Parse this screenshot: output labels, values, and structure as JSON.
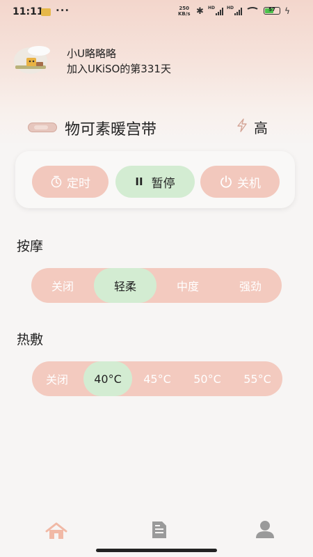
{
  "status_bar": {
    "time": "11:11",
    "more": "···",
    "net_speed_value": "250",
    "net_speed_unit": "KB/s",
    "hd1": "HD",
    "hd2": "HD",
    "battery": "57",
    "icons": [
      "notification-icon",
      "bluetooth-icon",
      "signal-icon",
      "wifi-icon",
      "battery-icon",
      "charging-icon"
    ]
  },
  "profile": {
    "username": "小U略略略",
    "days_text": "加入UKiSO的第331天"
  },
  "device": {
    "name": "物可素暖宫带",
    "level": "高"
  },
  "controls": {
    "timer_label": "定时",
    "pause_label": "暂停",
    "power_label": "关机",
    "pause_icon": "II"
  },
  "massage": {
    "title": "按摩",
    "options": [
      "关闭",
      "轻柔",
      "中度",
      "强劲"
    ],
    "selected": "轻柔"
  },
  "heat": {
    "title": "热敷",
    "options": [
      "关闭",
      "40°C",
      "45°C",
      "50°C",
      "55°C"
    ],
    "selected": "40°C"
  },
  "bottom_nav": {
    "items": [
      "home-icon",
      "document-icon",
      "profile-icon"
    ],
    "active": "home-icon"
  },
  "colors": {
    "accent_pink": "#f2c8bd",
    "accent_green": "#d3ecd2",
    "active_nav": "#f1b9a6",
    "inactive_nav": "#9a9a9a"
  }
}
